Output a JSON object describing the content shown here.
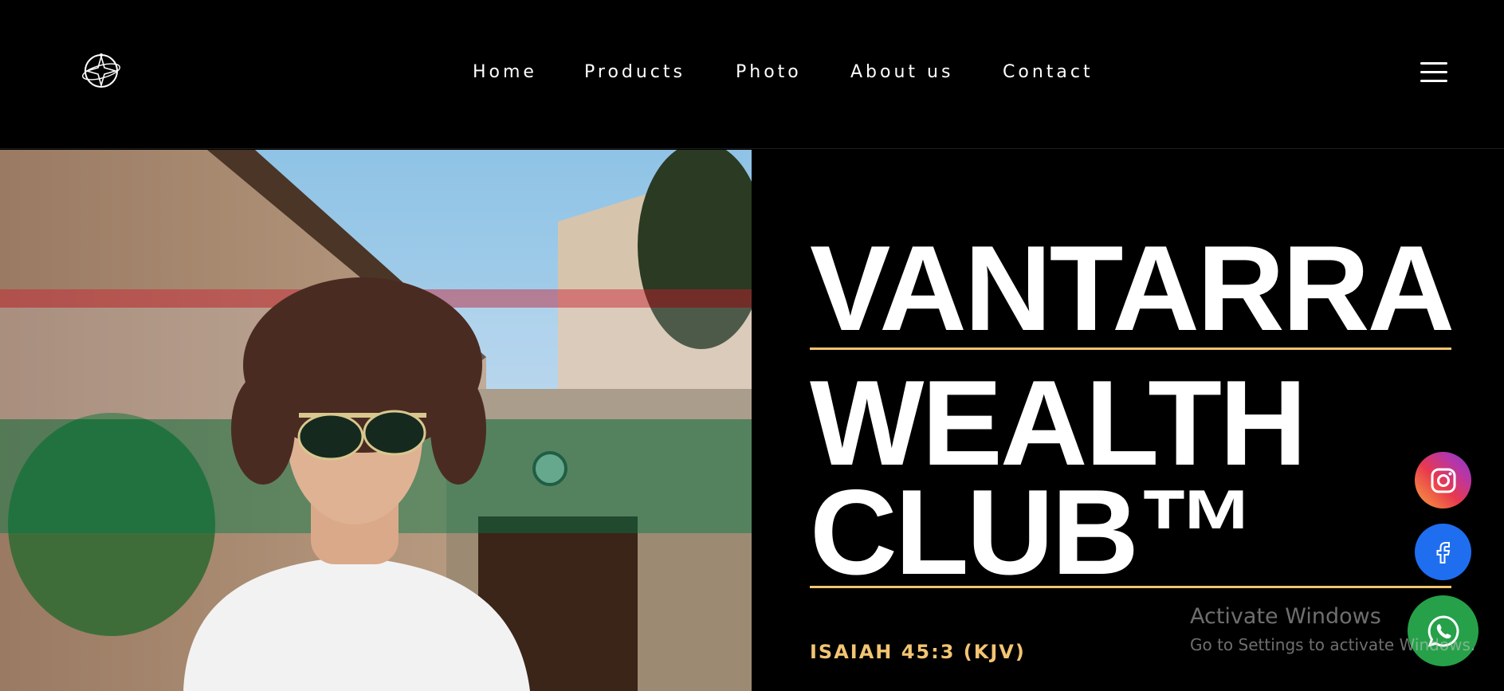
{
  "header": {
    "logo_icon": "compass-star-logo",
    "nav": [
      {
        "label": "Home"
      },
      {
        "label": "Products"
      },
      {
        "label": "Photo"
      },
      {
        "label": "About us"
      },
      {
        "label": "Contact"
      }
    ],
    "menu_icon": "hamburger-menu-icon"
  },
  "hero": {
    "image_description": "young man with curly hair and sunglasses in white t-shirt in front of house",
    "title_lines": [
      "VANTARRA",
      "WEALTH",
      "CLUB™"
    ],
    "verse_ref": "ISAIAH 45:3 (KJV)",
    "accent_color": "#f3c472"
  },
  "social": [
    {
      "name": "instagram",
      "icon": "instagram-icon",
      "color": "#d6336c"
    },
    {
      "name": "facebook",
      "icon": "facebook-icon",
      "color": "#1f6ef0"
    },
    {
      "name": "whatsapp",
      "icon": "whatsapp-icon",
      "color": "#26a149"
    }
  ],
  "watermark": {
    "line1": "Activate Windows",
    "line2": "Go to Settings to activate Windows."
  }
}
